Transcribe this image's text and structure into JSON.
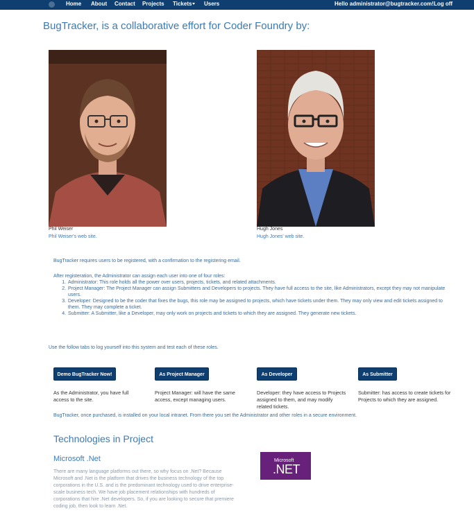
{
  "nav": {
    "logo_icon": "bug-logo-icon",
    "items": [
      "Home",
      "About",
      "Contact",
      "Projects",
      "Tickets"
    ],
    "users": "Users",
    "greeting": "Hello administrator@bugtracker.com!",
    "logoff": "Log off"
  },
  "headline": "BugTracker, is a collaborative effort for Coder Foundry by:",
  "people": [
    {
      "name": "Phil Weiser",
      "link": "Phil Weiser's web site."
    },
    {
      "name": "Hugh Jones",
      "link": "Hugh Jones' web site."
    }
  ],
  "info": {
    "registration": "BugTracker requires users to be registered, with a confirmation to the registering email.",
    "roles_intro": "After registeration, the Administrator can assign each user into one of four roles:",
    "roles": [
      "Administrator: This role holds all the power over users, projects, tickets, and related attachments.",
      "Project Manager: The Project Manager can assign Submitters and Developers to projects. They have full access to the site, like Administrators, except they may not manipulate users.",
      "Developer: Designed to be the coder that fixes the bugs, this role may be assigned to projects, which have tickets under them. They may only view and edit tickets assigned to them. They may complete a ticket.",
      "Submitter: A Submitter, like a Developer, may only work on projects and tickets to which they are assigned. They generate new tickets."
    ],
    "follow_tabs": "Use the follow tabs to log yourself into this system and test each of these roles."
  },
  "demo": [
    {
      "label": "Demo BugTracker Now!",
      "desc": "As the Administrator, you have full access to the site."
    },
    {
      "label": "As Project Manager",
      "desc": "Project Manager: will have the same access, except managing users."
    },
    {
      "label": "As Developer",
      "desc": "Developer: they have access to Projects assigned to them, and may modify related tickets."
    },
    {
      "label": "As Submitter",
      "desc": "Submitter: has access to create tickets for Projects to which they are assigned."
    }
  ],
  "installed": "BugTracker, once purchased, is installed on your local intranet. From there you set the Administrator and other roles in a secure environment.",
  "technologies": {
    "heading": "Technologies in Project",
    "subheading": "Microsoft .Net",
    "body": "There are many language platforms out there, so why focus on .Net? Because Microsoft and .Net is the platform that drives the business technology of the top corporations in the U.S. and is the predominant technology used to drive enterprise-scale business tech. We have job placement relationships with hundreds of corporations that hire .Net developers. So, if you are looking to secure that premiere coding job, then look to learn .Net.",
    "logo_small": "Microsoft",
    "logo_big": ".NET",
    "logo_color": "#68217a"
  },
  "colors": {
    "navbar": "#0f3e70",
    "accent": "#3a7ab8",
    "button": "#0f3e70"
  }
}
